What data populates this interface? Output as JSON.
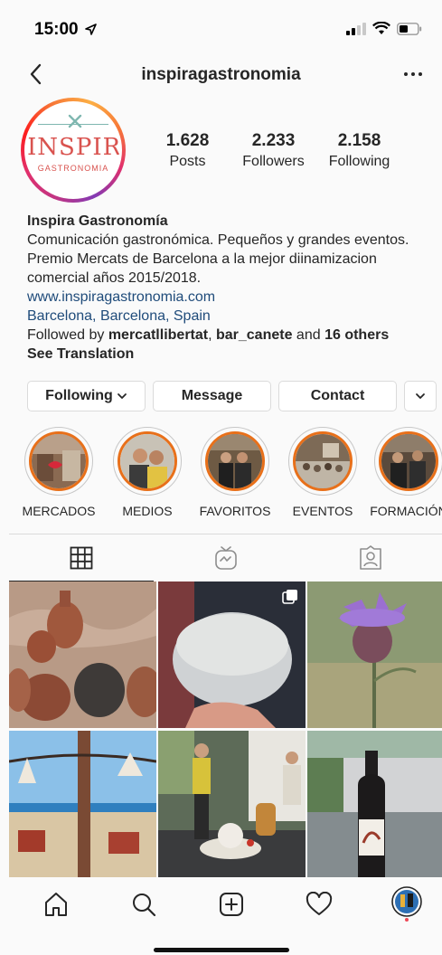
{
  "status_bar": {
    "time": "15:00"
  },
  "header": {
    "username": "inspiragastronomia"
  },
  "profile": {
    "logo_text": "INSPIRA",
    "logo_subtext": "GASTRONOMIA",
    "stats": [
      {
        "value": "1.628",
        "label": "Posts"
      },
      {
        "value": "2.233",
        "label": "Followers"
      },
      {
        "value": "2.158",
        "label": "Following"
      }
    ],
    "name": "Inspira Gastronomía",
    "bio_lines": [
      "Comunicación gastronómica. Pequeños y grandes eventos.",
      "Premio Mercats de Barcelona a la mejor diinamizacion",
      "comercial años 2015/2018."
    ],
    "website": "www.inspiragastronomia.com",
    "location": "Barcelona, Barcelona, Spain",
    "followed_by": {
      "prefix": "Followed by ",
      "user1": "mercatllibertat",
      "sep": ", ",
      "user2": "bar_canete",
      "mid": " and ",
      "others": "16 others"
    },
    "see_translation": "See Translation"
  },
  "buttons": {
    "following": "Following",
    "message": "Message",
    "contact": "Contact"
  },
  "highlights": [
    {
      "label": "MERCADOS"
    },
    {
      "label": "MEDIOS"
    },
    {
      "label": "FAVORITOS"
    },
    {
      "label": "EVENTOS"
    },
    {
      "label": "FORMACIÓN"
    }
  ],
  "tabs": [
    "grid-icon",
    "igtv-icon",
    "tagged-icon"
  ],
  "colors": {
    "link": "#1f4b7a",
    "highlight_ring": "#e8701a",
    "text": "#262626",
    "border": "#dbdbdb"
  }
}
